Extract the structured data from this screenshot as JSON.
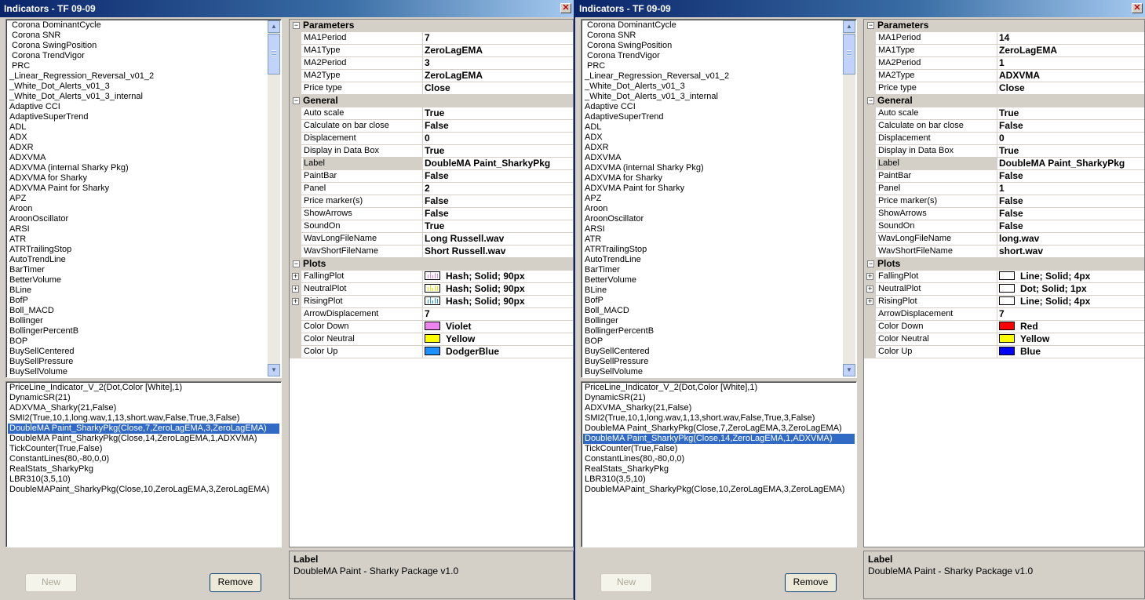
{
  "available_indicators": [
    {
      "label": "Corona DominantCycle",
      "indent": true
    },
    {
      "label": "Corona SNR",
      "indent": true
    },
    {
      "label": "Corona SwingPosition",
      "indent": true
    },
    {
      "label": "Corona TrendVigor",
      "indent": true
    },
    {
      "label": "PRC",
      "indent": true
    },
    {
      "label": "_Linear_Regression_Reversal_v01_2",
      "indent": false
    },
    {
      "label": "_White_Dot_Alerts_v01_3",
      "indent": false
    },
    {
      "label": "_White_Dot_Alerts_v01_3_internal",
      "indent": false
    },
    {
      "label": "Adaptive CCI",
      "indent": false
    },
    {
      "label": "AdaptiveSuperTrend",
      "indent": false
    },
    {
      "label": "ADL",
      "indent": false
    },
    {
      "label": "ADX",
      "indent": false
    },
    {
      "label": "ADXR",
      "indent": false
    },
    {
      "label": "ADXVMA",
      "indent": false
    },
    {
      "label": "ADXVMA (internal Sharky Pkg)",
      "indent": false
    },
    {
      "label": "ADXVMA for Sharky",
      "indent": false
    },
    {
      "label": "ADXVMA Paint for Sharky",
      "indent": false
    },
    {
      "label": "APZ",
      "indent": false
    },
    {
      "label": "Aroon",
      "indent": false
    },
    {
      "label": "AroonOscillator",
      "indent": false
    },
    {
      "label": "ARSI",
      "indent": false
    },
    {
      "label": "ATR",
      "indent": false
    },
    {
      "label": "ATRTrailingStop",
      "indent": false
    },
    {
      "label": "AutoTrendLine",
      "indent": false
    },
    {
      "label": "BarTimer",
      "indent": false
    },
    {
      "label": "BetterVolume",
      "indent": false
    },
    {
      "label": "BLine",
      "indent": false
    },
    {
      "label": "BofP",
      "indent": false
    },
    {
      "label": "Boll_MACD",
      "indent": false
    },
    {
      "label": "Bollinger",
      "indent": false
    },
    {
      "label": "BollingerPercentB",
      "indent": false
    },
    {
      "label": "BOP",
      "indent": false
    },
    {
      "label": "BuySellCentered",
      "indent": false
    },
    {
      "label": "BuySellPressure",
      "indent": false
    },
    {
      "label": "BuySellVolume",
      "indent": false
    }
  ],
  "added_indicators": [
    "PriceLine_Indicator_V_2(Dot,Color [White],1)",
    "DynamicSR(21)",
    "ADXVMA_Sharky(21,False)",
    "SMI2(True,10,1,long.wav,1,13,short.wav,False,True,3,False)",
    "DoubleMA Paint_SharkyPkg(Close,7,ZeroLagEMA,3,ZeroLagEMA)",
    "DoubleMA Paint_SharkyPkg(Close,14,ZeroLagEMA,1,ADXVMA)",
    "TickCounter(True,False)",
    "ConstantLines(80,-80,0,0)",
    "RealStats_SharkyPkg",
    "LBR310(3,5,10)",
    "DoubleMAPaint_SharkyPkg(Close,10,ZeroLagEMA,3,ZeroLagEMA)"
  ],
  "buttons": {
    "new": "New",
    "remove": "Remove"
  },
  "categories": {
    "parameters": "Parameters",
    "general": "General",
    "plots": "Plots"
  },
  "labels": {
    "ma1period": "MA1Period",
    "ma1type": "MA1Type",
    "ma2period": "MA2Period",
    "ma2type": "MA2Type",
    "pricetype": "Price type",
    "autoscale": "Auto scale",
    "calconbarclose": "Calculate on bar close",
    "displacement": "Displacement",
    "databox": "Display in Data Box",
    "label": "Label",
    "paintbar": "PaintBar",
    "panel": "Panel",
    "pricemarker": "Price marker(s)",
    "showarrows": "ShowArrows",
    "soundon": "SoundOn",
    "wavlong": "WavLongFileName",
    "wavshort": "WavShortFileName",
    "fallingplot": "FallingPlot",
    "neutralplot": "NeutralPlot",
    "risingplot": "RisingPlot",
    "arrowdisp": "ArrowDisplacement",
    "colordown": "Color Down",
    "colorneutral": "Color Neutral",
    "colorup": "Color Up"
  },
  "windows": {
    "left": {
      "title": "Indicators - TF 09-09",
      "selected_index": 4,
      "values": {
        "ma1period": "7",
        "ma1type": "ZeroLagEMA",
        "ma2period": "3",
        "ma2type": "ZeroLagEMA",
        "pricetype": "Close",
        "autoscale": "True",
        "calconbarclose": "False",
        "displacement": "0",
        "databox": "True",
        "label": "DoubleMA Paint_SharkyPkg",
        "paintbar": "False",
        "panel": "2",
        "pricemarker": "False",
        "showarrows": "False",
        "soundon": "True",
        "wavlong": "Long Russell.wav",
        "wavshort": "Short Russell.wav",
        "fallingplot": "Hash; Solid; 90px",
        "neutralplot": "Hash; Solid; 90px",
        "risingplot": "Hash; Solid; 90px",
        "arrowdisp": "7",
        "colordown": "Violet",
        "colorneutral": "Yellow",
        "colorup": "DodgerBlue"
      },
      "swatches": {
        "fallingplot": "#ee82ee",
        "neutralplot": "#e6e600",
        "risingplot": "#1e90ff",
        "colordown": "#ee82ee",
        "colorneutral": "#ffff00",
        "colorup": "#1e90ff"
      },
      "plot_style": "hash",
      "description": {
        "title": "Label",
        "text": "DoubleMA Paint - Sharky Package v1.0"
      }
    },
    "right": {
      "title": "Indicators - TF 09-09",
      "selected_index": 5,
      "values": {
        "ma1period": "14",
        "ma1type": "ZeroLagEMA",
        "ma2period": "1",
        "ma2type": "ADXVMA",
        "pricetype": "Close",
        "autoscale": "True",
        "calconbarclose": "False",
        "displacement": "0",
        "databox": "True",
        "label": "DoubleMA Paint_SharkyPkg",
        "paintbar": "False",
        "panel": "1",
        "pricemarker": "False",
        "showarrows": "False",
        "soundon": "False",
        "wavlong": "long.wav",
        "wavshort": "short.wav",
        "fallingplot": "Line; Solid; 4px",
        "neutralplot": "Dot; Solid; 1px",
        "risingplot": "Line; Solid; 4px",
        "arrowdisp": "7",
        "colordown": "Red",
        "colorneutral": "Yellow",
        "colorup": "Blue"
      },
      "swatches": {
        "fallingplot": "#ffffff",
        "neutralplot": "#ffffff",
        "risingplot": "#ffffff",
        "colordown": "#ff0000",
        "colorneutral": "#ffff00",
        "colorup": "#0000ff"
      },
      "plot_style": "solid",
      "description": {
        "title": "Label",
        "text": "DoubleMA Paint - Sharky Package v1.0"
      }
    }
  }
}
